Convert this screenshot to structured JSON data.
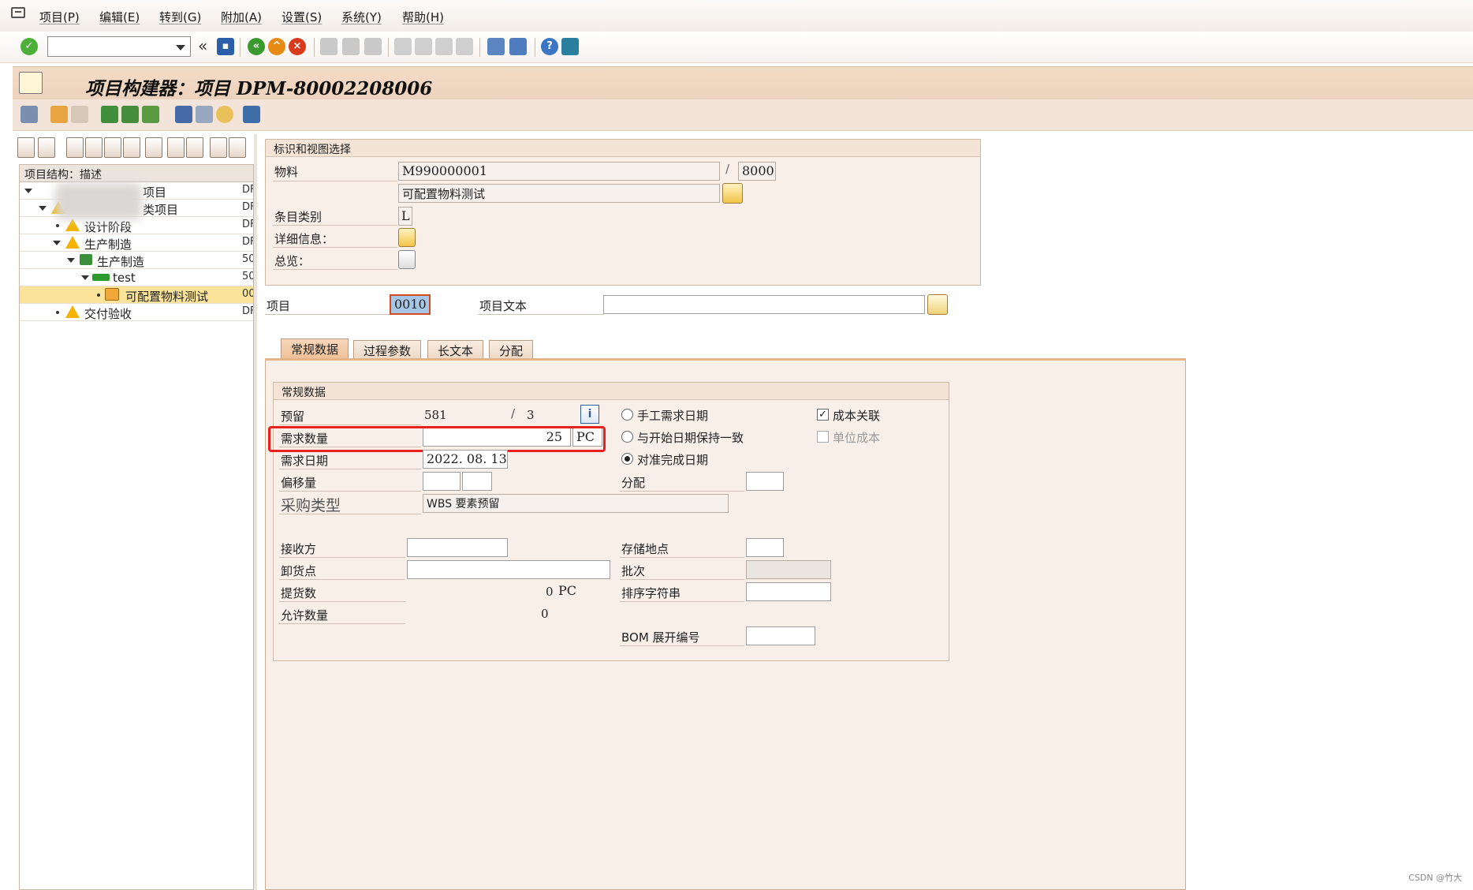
{
  "menu": {
    "items": [
      "项目(P)",
      "编辑(E)",
      "转到(G)",
      "附加(A)",
      "设置(S)",
      "系统(Y)",
      "帮助(H)"
    ]
  },
  "toolbar": {
    "command_field_value": "",
    "back_glyph": "«"
  },
  "title": {
    "text": "项目构建器：项目 DPM-80002208006"
  },
  "tree": {
    "header": "项目结构：描述",
    "rows": [
      {
        "label": "项目",
        "col2": "DF"
      },
      {
        "label": "类项目",
        "col2": "DF"
      },
      {
        "label": "设计阶段",
        "col2": "DF"
      },
      {
        "label": "生产制造",
        "col2": "DF"
      },
      {
        "label": "生产制造",
        "col2": "50"
      },
      {
        "label": "test",
        "col2": "50"
      },
      {
        "label": "可配置物料测试",
        "col2": "00"
      },
      {
        "label": "交付验收",
        "col2": "DF"
      }
    ]
  },
  "ident": {
    "group_title": "标识和视图选择",
    "material_label": "物料",
    "material_value": "M990000001",
    "plant_separator": "/",
    "plant_value": "8000",
    "material_desc": "可配置物料测试",
    "item_category_label": "条目类别",
    "item_category_value": "L",
    "details_label": "详细信息：",
    "overview_label": "总览："
  },
  "item": {
    "label": "项目",
    "value": "0010",
    "text_label": "项目文本",
    "text_value": ""
  },
  "tabs": [
    "常规数据",
    "过程参数",
    "长文本",
    "分配"
  ],
  "general": {
    "group_title": "常规数据",
    "reservation_label": "预留",
    "reservation_value": "581",
    "reservation_sep": "/",
    "reservation_item": "3",
    "req_qty_label": "需求数量",
    "req_qty_value": "25",
    "req_qty_unit": "PC",
    "req_date_label": "需求日期",
    "req_date_value": "2022. 08. 13",
    "offset_label": "偏移量",
    "proc_type_label": "采购类型",
    "proc_type_value": "WBS 要素预留",
    "radio_manual": "手工需求日期",
    "radio_start": "与开始日期保持一致",
    "radio_finish": "对准完成日期",
    "cost_relevant": "成本关联",
    "unit_cost": "单位成本",
    "distribution_label": "分配",
    "recipient_label": "接收方",
    "unloading_label": "卸货点",
    "withdrawn_label": "提货数",
    "withdrawn_value": "0",
    "withdrawn_unit": "PC",
    "permitted_label": "允许数量",
    "permitted_value": "0",
    "storage_label": "存储地点",
    "batch_label": "批次",
    "sort_label": "排序字符串",
    "bom_label": "BOM 展开编号"
  },
  "footer": {
    "watermark": "CSDN @竹大"
  },
  "colors": {
    "title_bg": "#ecd2bb",
    "highlight_red": "#e8201e",
    "selected_tree_row": "#fbe39a"
  }
}
